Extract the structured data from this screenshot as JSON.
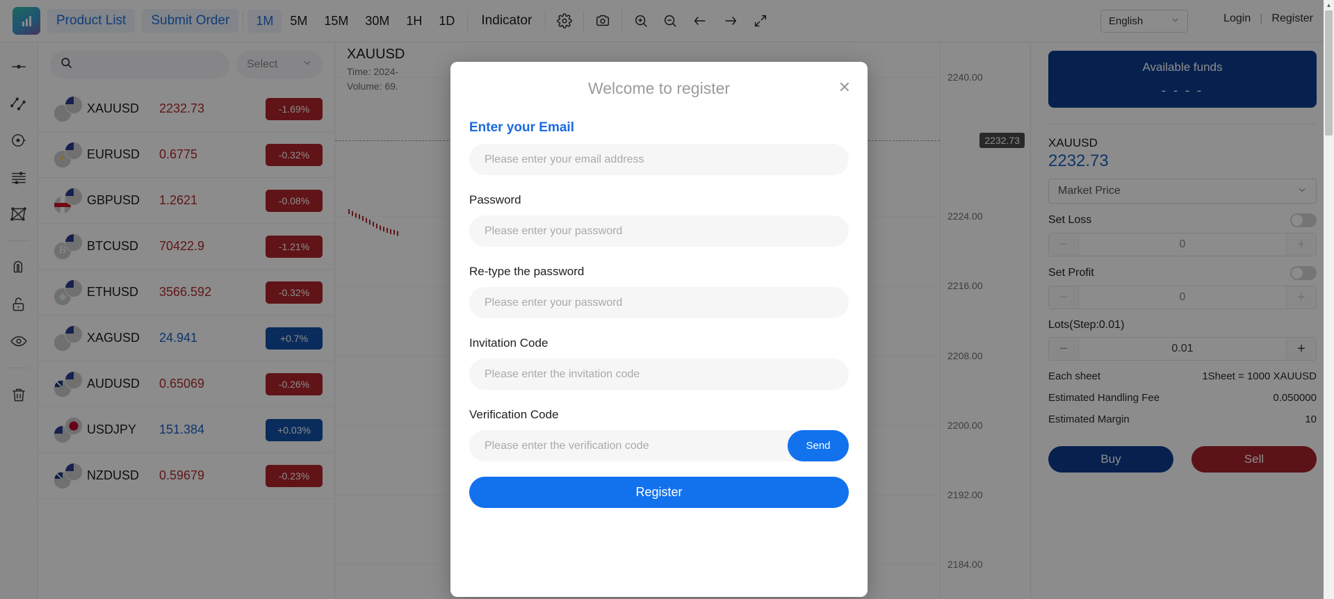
{
  "topbar": {
    "logo_icon": "chart-logo-icon",
    "nav": [
      {
        "label": "Product List",
        "name": "product-list"
      },
      {
        "label": "Submit Order",
        "name": "submit-order"
      }
    ],
    "timeframes": [
      {
        "label": "1M",
        "active": true
      },
      {
        "label": "5M",
        "active": false
      },
      {
        "label": "15M",
        "active": false
      },
      {
        "label": "30M",
        "active": false
      },
      {
        "label": "1H",
        "active": false
      },
      {
        "label": "1D",
        "active": false
      }
    ],
    "indicator_label": "Indicator",
    "icons": [
      "gear-icon",
      "camera-icon",
      "zoom-in-icon",
      "zoom-out-icon",
      "arrow-left-icon",
      "arrow-right-icon",
      "fullscreen-icon"
    ],
    "language": "English",
    "login_label": "Login",
    "divider": "|",
    "register_label": "Register"
  },
  "tool_rail": {
    "icons": [
      "crosshair-line-icon",
      "trend-lines-icon",
      "circle-dot-icon",
      "horizontal-lines-icon",
      "shapes-icon",
      "magnet-icon",
      "unlock-icon",
      "eye-icon",
      "trash-icon"
    ]
  },
  "symbol_panel": {
    "search_placeholder": "",
    "search_value": "",
    "sort_label": "Select",
    "rows": [
      {
        "symbol": "XAUUSD",
        "price": "2232.73",
        "change": "-1.69%",
        "dir": "down",
        "flag_front": "flag-gold",
        "flag_back": "flag-us"
      },
      {
        "symbol": "EURUSD",
        "price": "0.6775",
        "change": "-0.32%",
        "dir": "down",
        "flag_front": "flag-eu",
        "flag_back": "flag-us"
      },
      {
        "symbol": "GBPUSD",
        "price": "1.2621",
        "change": "-0.08%",
        "dir": "down",
        "flag_front": "flag-gb",
        "flag_back": "flag-us"
      },
      {
        "symbol": "BTCUSD",
        "price": "70422.9",
        "change": "-1.21%",
        "dir": "down",
        "flag_front": "flag-btc",
        "flag_back": "flag-us"
      },
      {
        "symbol": "ETHUSD",
        "price": "3566.592",
        "change": "-0.32%",
        "dir": "down",
        "flag_front": "flag-eth",
        "flag_back": "flag-us"
      },
      {
        "symbol": "XAGUSD",
        "price": "24.941",
        "change": "+0.7%",
        "dir": "up",
        "flag_front": "flag-silver",
        "flag_back": "flag-us"
      },
      {
        "symbol": "AUDUSD",
        "price": "0.65069",
        "change": "-0.26%",
        "dir": "down",
        "flag_front": "flag-au",
        "flag_back": "flag-us"
      },
      {
        "symbol": "USDJPY",
        "price": "151.384",
        "change": "+0.03%",
        "dir": "up",
        "flag_front": "flag-us",
        "flag_back": "flag-jp"
      },
      {
        "symbol": "NZDUSD",
        "price": "0.59679",
        "change": "-0.23%",
        "dir": "down",
        "flag_front": "flag-nz",
        "flag_back": "flag-us"
      }
    ]
  },
  "chart": {
    "symbol": "XAUUSD",
    "time_label": "Time: 2024-",
    "volume_label": "Volume: 69.",
    "current_price": "2232.73",
    "axis_ticks": [
      "2240.00",
      "2224.00",
      "2216.00",
      "2208.00",
      "2200.00",
      "2192.00",
      "2184.00"
    ]
  },
  "chart_data": {
    "type": "line",
    "title": "XAUUSD",
    "ylabel": "",
    "xlabel": "",
    "ylim": [
      2180,
      2244
    ],
    "ytick_values": [
      2240,
      2232.73,
      2224,
      2216,
      2208,
      2200,
      2192,
      2184
    ],
    "ytick_labels": [
      "2240.00",
      "2232.73",
      "2224.00",
      "2216.00",
      "2208.00",
      "2200.00",
      "2192.00",
      "2184.00"
    ],
    "grid": true,
    "legend": false,
    "annotations": [
      {
        "text": "2232.73",
        "type": "current-price-tag"
      }
    ],
    "series": [
      {
        "name": "XAUUSD price",
        "values": [
          2233.2,
          2232.9,
          2232.6,
          2232.4,
          2232.1,
          2231.8,
          2231.5,
          2231.2,
          2230.9,
          2230.6,
          2230.4,
          2230.2,
          2230.0,
          2229.9,
          2229.7,
          2232.73
        ]
      }
    ]
  },
  "order_panel": {
    "funds_title": "Available funds",
    "funds_value": "- - - -",
    "symbol": "XAUUSD",
    "price": "2232.73",
    "order_type": "Market Price",
    "set_loss_label": "Set Loss",
    "set_loss_value": "0",
    "set_loss_on": false,
    "set_profit_label": "Set Profit",
    "set_profit_value": "0",
    "set_profit_on": false,
    "lots_label": "Lots(Step:0.01)",
    "lots_value": "0.01",
    "minus_label": "−",
    "plus_label": "+",
    "info": [
      {
        "label": "Each sheet",
        "value": "1Sheet = 1000 XAUUSD"
      },
      {
        "label": "Estimated Handling Fee",
        "value": "0.050000"
      },
      {
        "label": "Estimated Margin",
        "value": "10"
      }
    ],
    "buy_label": "Buy",
    "sell_label": "Sell"
  },
  "modal": {
    "title": "Welcome to register",
    "close_icon": "close-icon",
    "fields": [
      {
        "label": "Enter your Email",
        "placeholder": "Please enter your email address",
        "accent": true,
        "name": "email"
      },
      {
        "label": "Password",
        "placeholder": "Please enter your password",
        "accent": false,
        "name": "password"
      },
      {
        "label": "Re-type the password",
        "placeholder": "Please enter your password",
        "accent": false,
        "name": "confirm-password"
      },
      {
        "label": "Invitation Code",
        "placeholder": "Please enter the invitation code",
        "accent": false,
        "name": "invitation-code"
      }
    ],
    "verification_label": "Verification Code",
    "verification_placeholder": "Please enter the verification code",
    "send_label": "Send",
    "register_label": "Register"
  },
  "colors": {
    "accent_blue": "#1272ee",
    "nav_blue": "#1f6fd6",
    "down_red": "#b0252a",
    "up_blue": "#1351a8",
    "funds_navy": "#0d3c91",
    "sell_red": "#a6232b"
  }
}
